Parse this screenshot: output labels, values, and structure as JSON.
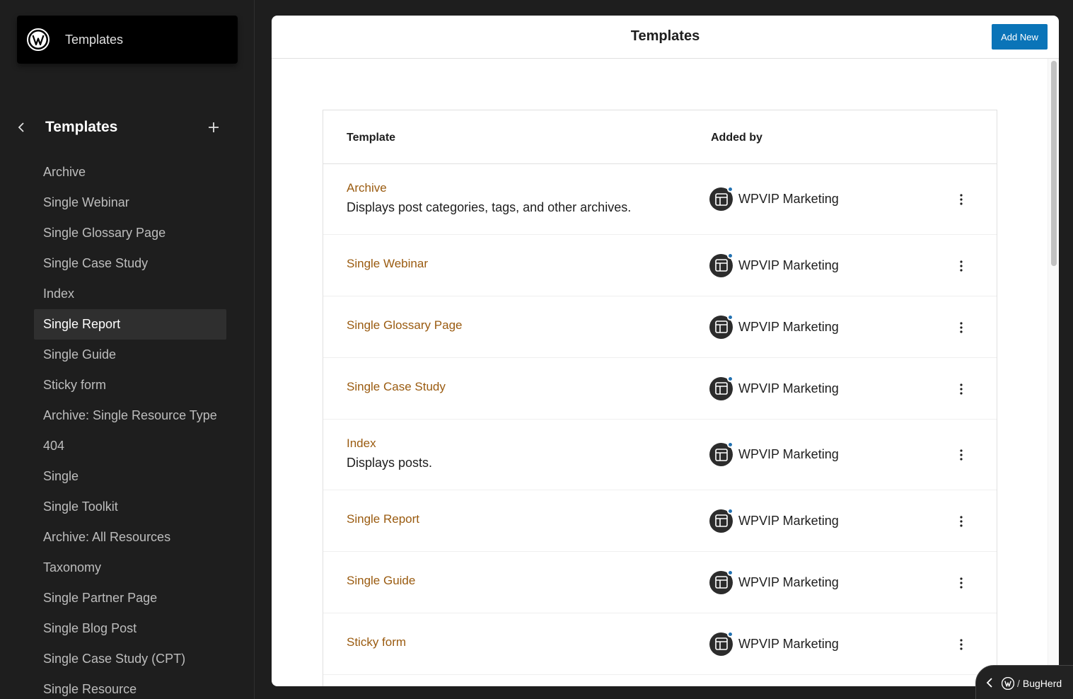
{
  "sidebar": {
    "site_title": "Templates",
    "nav_title": "Templates",
    "items": [
      {
        "label": "Archive"
      },
      {
        "label": "Single Webinar"
      },
      {
        "label": "Single Glossary Page"
      },
      {
        "label": "Single Case Study"
      },
      {
        "label": "Index"
      },
      {
        "label": "Single Report",
        "active": true
      },
      {
        "label": "Single Guide"
      },
      {
        "label": "Sticky form"
      },
      {
        "label": "Archive: Single Resource Type"
      },
      {
        "label": "404"
      },
      {
        "label": "Single"
      },
      {
        "label": "Single Toolkit"
      },
      {
        "label": "Archive: All Resources"
      },
      {
        "label": "Taxonomy"
      },
      {
        "label": "Single Partner Page"
      },
      {
        "label": "Single Blog Post"
      },
      {
        "label": "Single Case Study (CPT)"
      },
      {
        "label": "Single Resource"
      }
    ]
  },
  "main": {
    "title": "Templates",
    "add_new_label": "Add New",
    "columns": {
      "template": "Template",
      "added_by": "Added by"
    },
    "rows": [
      {
        "title": "Archive",
        "description": "Displays post categories, tags, and other archives.",
        "author": "WPVIP Marketing"
      },
      {
        "title": "Single Webinar",
        "description": "",
        "author": "WPVIP Marketing"
      },
      {
        "title": "Single Glossary Page",
        "description": "",
        "author": "WPVIP Marketing"
      },
      {
        "title": "Single Case Study",
        "description": "",
        "author": "WPVIP Marketing"
      },
      {
        "title": "Index",
        "description": "Displays posts.",
        "author": "WPVIP Marketing"
      },
      {
        "title": "Single Report",
        "description": "",
        "author": "WPVIP Marketing"
      },
      {
        "title": "Single Guide",
        "description": "",
        "author": "WPVIP Marketing"
      },
      {
        "title": "Sticky form",
        "description": "",
        "author": "WPVIP Marketing"
      }
    ]
  },
  "bugherd": {
    "label": "BugHerd",
    "separator": "/"
  },
  "colors": {
    "accent": "#0a74b8",
    "link": "#9a5b10",
    "sidebar_bg": "#1e1e1e"
  }
}
